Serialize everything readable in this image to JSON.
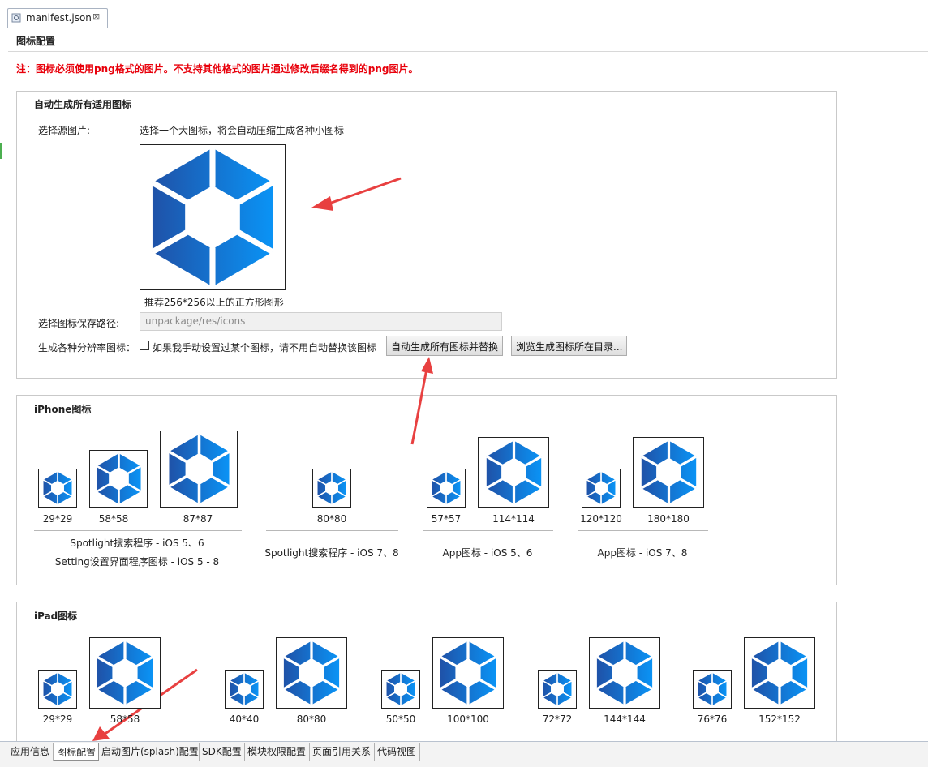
{
  "editor_tab": {
    "label": "manifest.json",
    "close": "⊠"
  },
  "page_title": "图标配置",
  "notice": "注：图标必须使用png格式的图片。不支持其他格式的图片通过修改后缀名得到的png图片。",
  "auto_section": {
    "title": "自动生成所有适用图标",
    "source_label": "选择源图片:",
    "source_hint": "选择一个大图标，将会自动压缩生成各种小图标",
    "recommend": "推荐256*256以上的正方形图形",
    "save_path_label": "选择图标保存路径:",
    "save_path_value": "unpackage/res/icons",
    "generate_label": "生成各种分辨率图标：",
    "checkbox_label": "如果我手动设置过某个图标，请不用自动替换该图标",
    "generate_button": "自动生成所有图标并替换",
    "browse_button": "浏览生成图标所在目录..."
  },
  "iphone_section": {
    "title": "iPhone图标",
    "groups": [
      {
        "sizes": [
          "29*29",
          "58*58",
          "87*87"
        ],
        "captions": [
          "Spotlight搜索程序 - iOS 5、6",
          "Setting设置界面程序图标 - iOS 5 - 8"
        ]
      },
      {
        "sizes": [
          "80*80"
        ],
        "captions": [
          "Spotlight搜索程序 - iOS 7、8"
        ]
      },
      {
        "sizes": [
          "57*57",
          "114*114"
        ],
        "captions": [
          "App图标 - iOS 5、6"
        ]
      },
      {
        "sizes": [
          "120*120",
          "180*180"
        ],
        "captions": [
          "App图标 - iOS 7、8"
        ]
      }
    ]
  },
  "ipad_section": {
    "title": "iPad图标",
    "groups": [
      {
        "sizes": [
          "29*29",
          "58*58"
        ]
      },
      {
        "sizes": [
          "40*40",
          "80*80"
        ]
      },
      {
        "sizes": [
          "50*50",
          "100*100"
        ]
      },
      {
        "sizes": [
          "72*72",
          "144*144"
        ]
      },
      {
        "sizes": [
          "76*76",
          "152*152"
        ]
      }
    ]
  },
  "bottom_tabs": [
    "应用信息",
    "图标配置",
    "启动图片(splash)配置",
    "SDK配置",
    "模块权限配置",
    "页面引用关系",
    "代码视图"
  ],
  "colors": {
    "notice": "#e8000b",
    "icon_dark": "#1f4ea8",
    "icon_light": "#0a8ff0",
    "arrow": "#e84040"
  }
}
